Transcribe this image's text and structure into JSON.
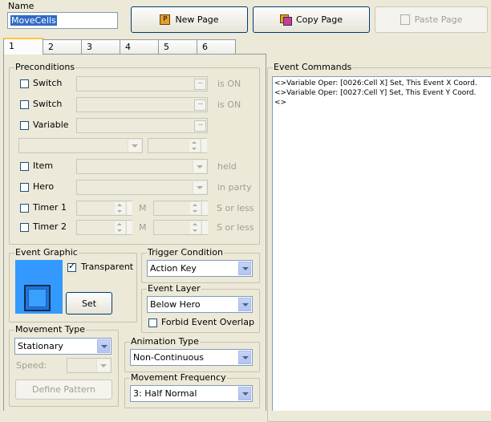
{
  "name": {
    "label": "Name",
    "value": "MoveCells"
  },
  "toolbar": {
    "new_page": "New Page",
    "copy_page": "Copy Page",
    "paste_page": "Paste Page"
  },
  "tabs": [
    "1",
    "2",
    "3",
    "4",
    "5",
    "6"
  ],
  "preconditions": {
    "title": "Preconditions",
    "switch1": {
      "label": "Switch",
      "suffix": "is ON"
    },
    "switch2": {
      "label": "Switch",
      "suffix": "is ON"
    },
    "variable": {
      "label": "Variable"
    },
    "item": {
      "label": "Item",
      "suffix": "held"
    },
    "hero": {
      "label": "Hero",
      "suffix": "in party"
    },
    "timer1": {
      "label": "Timer 1",
      "min": "M",
      "suffix": "S or less"
    },
    "timer2": {
      "label": "Timer 2",
      "min": "M",
      "suffix": "S or less"
    }
  },
  "event_graphic": {
    "title": "Event Graphic",
    "transparent": "Transparent",
    "set": "Set"
  },
  "trigger": {
    "title": "Trigger Condition",
    "value": "Action Key"
  },
  "layer": {
    "title": "Event Layer",
    "value": "Below Hero",
    "forbid": "Forbid Event Overlap"
  },
  "movement": {
    "title": "Movement Type",
    "value": "Stationary",
    "speed": "Speed:",
    "define": "Define Pattern"
  },
  "animation": {
    "title": "Animation Type",
    "value": "Non-Continuous"
  },
  "frequency": {
    "title": "Movement Frequency",
    "value": "3: Half Normal"
  },
  "commands": {
    "title": "Event Commands",
    "lines": [
      "<>Variable Oper: [0026:Cell X] Set, This Event X Coord.",
      "<>Variable Oper: [0027:Cell Y] Set, This Event Y Coord.",
      "<>"
    ]
  }
}
